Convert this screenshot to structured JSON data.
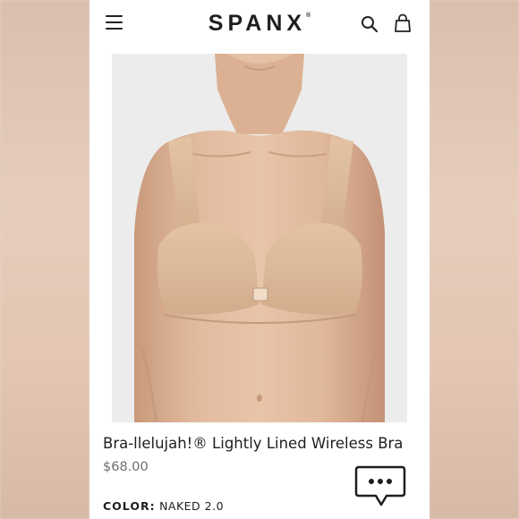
{
  "header": {
    "brand": "SPANX",
    "brand_mark": "®",
    "menu_icon": "hamburger-menu-icon",
    "search_icon": "search-icon",
    "bag_icon": "shopping-bag-icon"
  },
  "product": {
    "title": "Bra-llelujah!® Lightly Lined Wireless Bra",
    "price": "$68.00",
    "color_label": "COLOR:",
    "color_value": "NAKED 2.0",
    "image": "product-photo-model-wearing-nude-bra"
  },
  "chat": {
    "icon": "chat-bubble-icon"
  },
  "colors": {
    "background": "#ffffff",
    "text": "#1e1e1e",
    "price": "#6d6d6d",
    "skin": "#ddb394",
    "bra": "#dcb998",
    "photo_bg": "#ececec"
  }
}
